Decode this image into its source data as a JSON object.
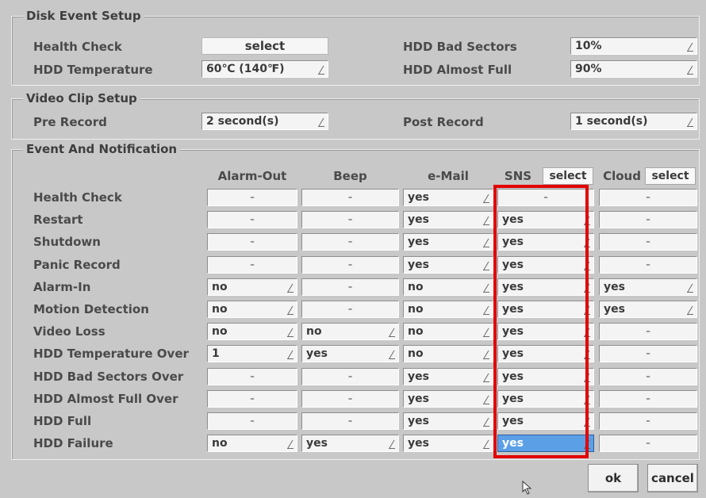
{
  "disk_event_setup": {
    "title": "Disk Event Setup",
    "health_check_label": "Health Check",
    "health_check_value": "select",
    "hdd_temperature_label": "HDD Temperature",
    "hdd_temperature_value": "60℃ (140℉)",
    "hdd_bad_sectors_label": "HDD Bad Sectors",
    "hdd_bad_sectors_value": "10%",
    "hdd_almost_full_label": "HDD Almost Full",
    "hdd_almost_full_value": "90%"
  },
  "video_clip_setup": {
    "title": "Video Clip Setup",
    "pre_record_label": "Pre Record",
    "pre_record_value": "2 second(s)",
    "post_record_label": "Post Record",
    "post_record_value": "1 second(s)"
  },
  "event_notification": {
    "title": "Event And Notification",
    "columns": {
      "alarm_out": "Alarm-Out",
      "beep": "Beep",
      "email": "e-Mail",
      "sns": "SNS",
      "sns_select": "select",
      "cloud": "Cloud",
      "cloud_select": "select"
    },
    "rows": [
      {
        "label": "Health Check",
        "alarm_out": "-",
        "beep": "-",
        "email": "yes",
        "sns": "-",
        "cloud": "-"
      },
      {
        "label": "Restart",
        "alarm_out": "-",
        "beep": "-",
        "email": "yes",
        "sns": "yes",
        "cloud": "-"
      },
      {
        "label": "Shutdown",
        "alarm_out": "-",
        "beep": "-",
        "email": "yes",
        "sns": "yes",
        "cloud": "-"
      },
      {
        "label": "Panic Record",
        "alarm_out": "-",
        "beep": "-",
        "email": "yes",
        "sns": "yes",
        "cloud": "-"
      },
      {
        "label": "Alarm-In",
        "alarm_out": "no",
        "beep": "-",
        "email": "no",
        "sns": "yes",
        "cloud": "yes"
      },
      {
        "label": "Motion Detection",
        "alarm_out": "no",
        "beep": "-",
        "email": "no",
        "sns": "yes",
        "cloud": "yes"
      },
      {
        "label": "Video Loss",
        "alarm_out": "no",
        "beep": "no",
        "email": "no",
        "sns": "yes",
        "cloud": "-"
      },
      {
        "label": "HDD Temperature Over",
        "alarm_out": "1",
        "beep": "yes",
        "email": "no",
        "sns": "yes",
        "cloud": "-"
      },
      {
        "label": "HDD Bad Sectors Over",
        "alarm_out": "-",
        "beep": "-",
        "email": "yes",
        "sns": "yes",
        "cloud": "-"
      },
      {
        "label": "HDD Almost Full Over",
        "alarm_out": "-",
        "beep": "-",
        "email": "yes",
        "sns": "yes",
        "cloud": "-"
      },
      {
        "label": "HDD Full",
        "alarm_out": "-",
        "beep": "-",
        "email": "yes",
        "sns": "yes",
        "cloud": "-"
      },
      {
        "label": "HDD Failure",
        "alarm_out": "no",
        "beep": "yes",
        "email": "yes",
        "sns": "yes",
        "cloud": "-"
      }
    ]
  },
  "buttons": {
    "ok": "ok",
    "cancel": "cancel"
  },
  "colors": {
    "highlight": "#5b9fe6",
    "annotation_box": "#e30000",
    "background": "#c8c8c8"
  }
}
